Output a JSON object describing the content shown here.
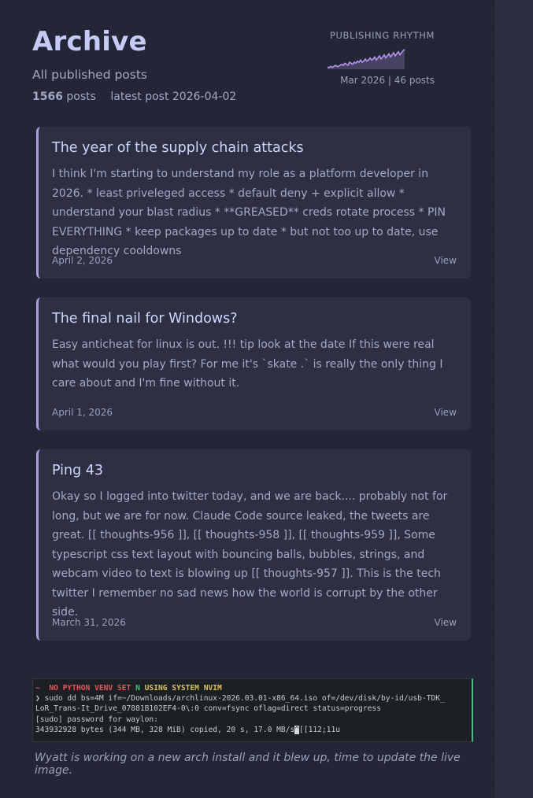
{
  "header": {
    "title": "Archive",
    "subtitle": "All published posts",
    "post_count": "1566",
    "post_count_label": "posts",
    "latest_label": "latest post 2026-04-02"
  },
  "rhythm": {
    "label": "PUBLISHING RHYTHM",
    "meta": "Mar 2026 | 46 posts",
    "series": [
      1,
      1,
      2,
      1,
      2,
      3,
      2,
      2,
      3,
      4,
      3,
      5,
      4,
      3,
      6,
      5,
      4,
      6,
      5,
      7,
      6,
      8,
      6,
      7,
      9,
      7,
      8,
      10,
      8,
      9,
      11,
      8,
      10,
      12,
      9,
      11,
      13,
      10,
      12,
      14,
      11,
      13,
      15,
      12,
      14,
      16,
      13,
      15,
      17,
      18
    ],
    "color": "#b394ea"
  },
  "posts": [
    {
      "title": "The year of the supply chain attacks",
      "excerpt": "I think I'm starting to understand my role as a platform developer in 2026. * least priveleged access * default deny + explicit allow * understand your blast radius * **GREASED** creds rotate process * PIN EVERYTHING * keep packages up to date * but not too up to date, use dependency cooldowns",
      "date": "April 2, 2026",
      "action": "View"
    },
    {
      "title": "The final nail for Windows?",
      "excerpt": "Easy anticheat for linux is out. !!! tip look at the date If this were real what would you play first? For me it's `skate .` is really the only thing I care about and I'm fine without it.",
      "date": "April 1, 2026",
      "action": "View"
    },
    {
      "title": "Ping 43",
      "excerpt": "Okay so I logged into twitter today, and we are back.... probably not for long, but we are for now. Claude Code source leaked, the tweets are great. [[ thoughts-956 ]], [[ thoughts-958 ]], [[ thoughts-959 ]], Some typescript css text layout with bouncing balls, bubbles, strings, and webcam video to text is blowing up [[ thoughts-957 ]]. This is the tech twitter I remember no sad news how the world is corrupt by the other side.",
      "date": "March 31, 2026",
      "action": "View"
    }
  ],
  "terminal": {
    "prompt_warn": "~  NO PYTHON VENV SET ",
    "prompt_info": "USING SYSTEM NVIM",
    "prompt_icon": "N",
    "line1": "❯ sudo dd bs=4M if=~/Downloads/archlinux-2026.03.01-x86_64.iso of=/dev/disk/by-id/usb-TDK_",
    "line2": "LoR_Trans-It_Drive_07881B102EF4-0\\:0 conv=fsync oflag=direct status=progress",
    "line3": "[sudo] password for waylon:",
    "line4_pre": "343932928 bytes (344 MB, 328 MiB) copied, 20 s, 17.0 MB/s",
    "line4_cursor": "^",
    "line4_post": "[[112;11u"
  },
  "caption": "Wyatt is working on a new arch install and it blew up, time to update the live image."
}
